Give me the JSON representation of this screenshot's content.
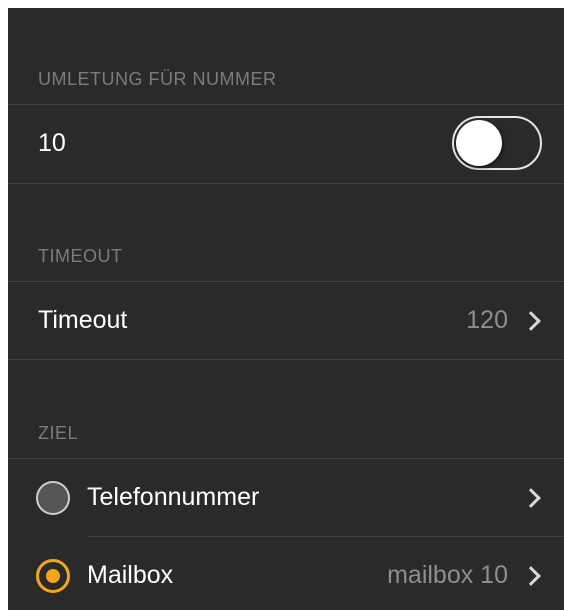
{
  "sections": {
    "redirect": {
      "header": "UMLETUNG FÜR NUMMER",
      "row_label": "10",
      "toggle_on": false
    },
    "timeout": {
      "header": "TIMEOUT",
      "row_label": "Timeout",
      "row_value": "120"
    },
    "target": {
      "header": "ZIEL",
      "options": [
        {
          "label": "Telefonnummer",
          "value": "",
          "selected": false
        },
        {
          "label": "Mailbox",
          "value": "mailbox 10",
          "selected": true
        }
      ]
    }
  },
  "colors": {
    "background": "#2a2a2a",
    "separator": "#3e3e3e",
    "header_text": "#7c7c7c",
    "accent": "#f7a51a"
  }
}
